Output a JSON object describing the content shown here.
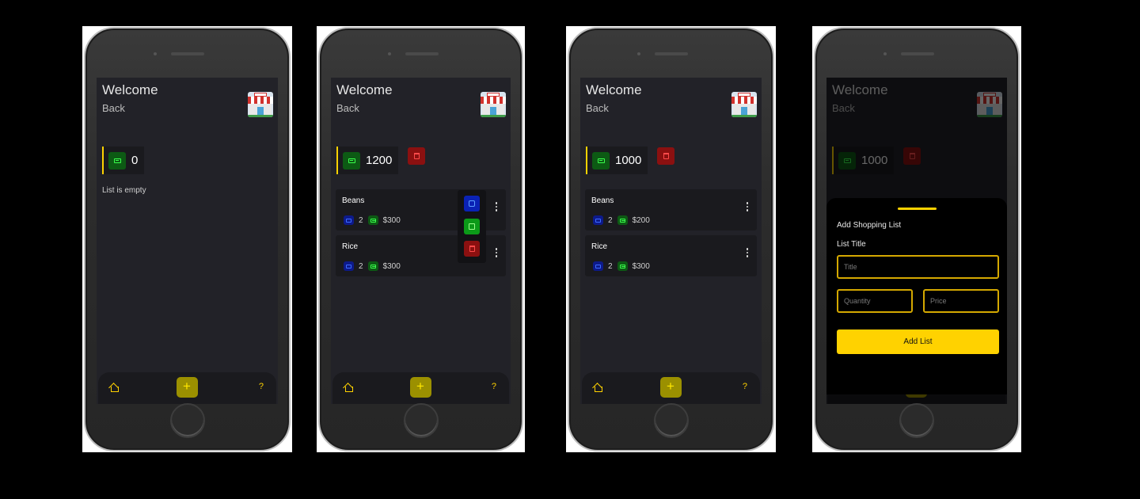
{
  "header": {
    "welcome": "Welcome",
    "back": "Back"
  },
  "screens": [
    {
      "id": "empty",
      "balance": "0",
      "empty_text": "List is empty"
    },
    {
      "id": "menu-open",
      "balance": "1200",
      "items": [
        {
          "title": "Beans",
          "quantity": "2",
          "price": "$300"
        },
        {
          "title": "Rice",
          "quantity": "2",
          "price": "$300"
        }
      ]
    },
    {
      "id": "updated",
      "balance": "1000",
      "items": [
        {
          "title": "Beans",
          "quantity": "2",
          "price": "$200"
        },
        {
          "title": "Rice",
          "quantity": "2",
          "price": "$300"
        }
      ]
    },
    {
      "id": "add-sheet",
      "balance": "1000"
    }
  ],
  "nav": {
    "add_glyph": "+",
    "help_glyph": "?"
  },
  "sheet": {
    "heading": "Add Shopping List",
    "list_title_label": "List Title",
    "title_placeholder": "Title",
    "quantity_placeholder": "Quantity",
    "price_placeholder": "Price",
    "add_label": "Add List"
  },
  "colors": {
    "accent": "#ffd200",
    "background": "#222228",
    "card": "#1a1a1e",
    "wallet_green": "#0d5a14",
    "delete_red": "#8b1010",
    "view_blue": "#0a22b5"
  },
  "icons": [
    "home-icon",
    "add-icon",
    "help-icon",
    "wallet-icon",
    "trash-icon",
    "quantity-icon",
    "price-icon",
    "more-options-icon",
    "view-icon",
    "edit-icon",
    "store-icon"
  ]
}
